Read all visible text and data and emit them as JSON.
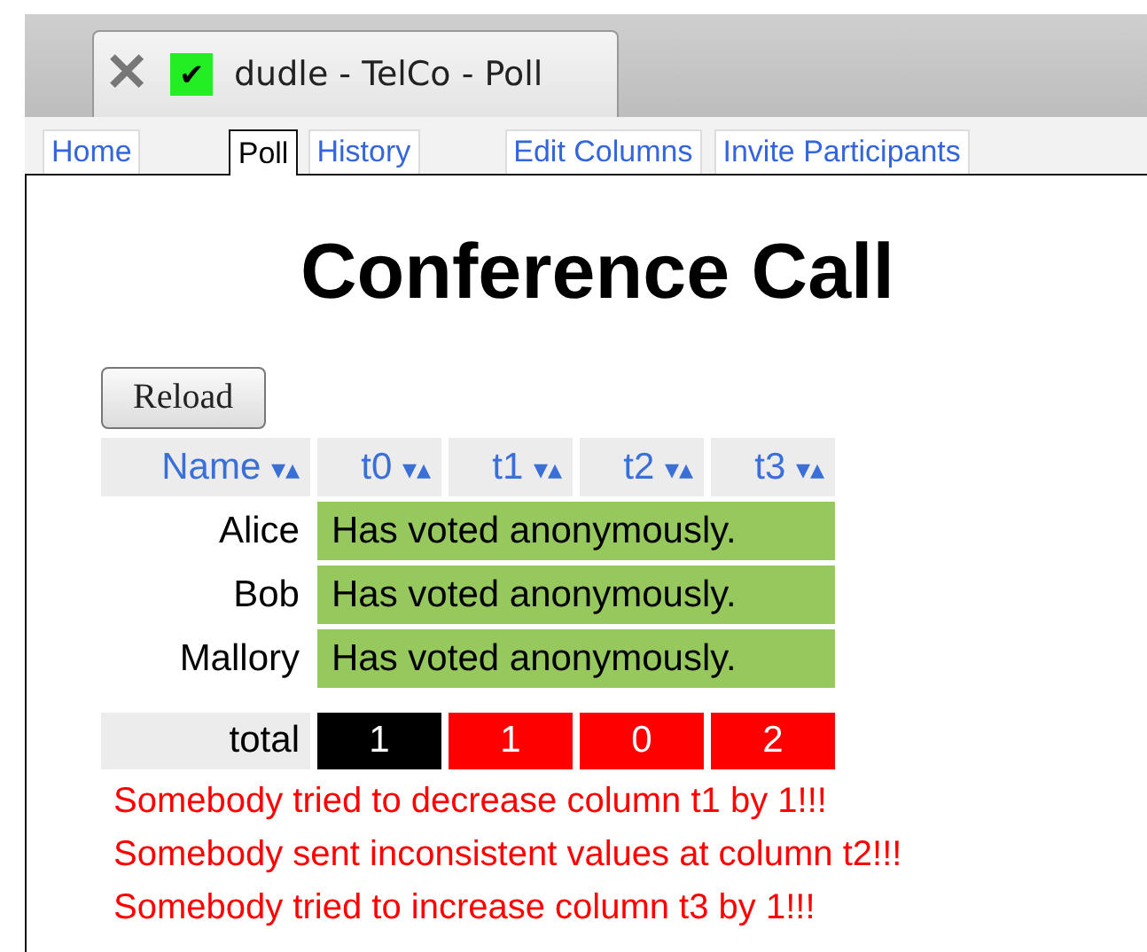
{
  "browser_tab": {
    "title": "dudle - TelCo - Poll",
    "close": "✕",
    "favicon": "✔"
  },
  "nav_tabs": [
    {
      "label": "Home",
      "selected": false
    },
    {
      "label": "Poll",
      "selected": true
    },
    {
      "label": "History",
      "selected": false
    },
    {
      "label": "Edit Columns",
      "selected": false
    },
    {
      "label": "Invite Participants",
      "selected": false
    }
  ],
  "heading": "Conference Call",
  "reload_button": "Reload",
  "table": {
    "columns": [
      {
        "label": "Name",
        "sort": "▾▴"
      },
      {
        "label": "t0",
        "sort": "▾▴"
      },
      {
        "label": "t1",
        "sort": "▾▴"
      },
      {
        "label": "t2",
        "sort": "▾▴"
      },
      {
        "label": "t3",
        "sort": "▾▴"
      }
    ],
    "rows": [
      {
        "name": "Alice",
        "vote": "Has voted anonymously."
      },
      {
        "name": "Bob",
        "vote": "Has voted anonymously."
      },
      {
        "name": "Mallory",
        "vote": "Has voted anonymously."
      }
    ],
    "total": {
      "label": "total",
      "cells": [
        {
          "value": "1",
          "valid": true
        },
        {
          "value": "1",
          "valid": false
        },
        {
          "value": "0",
          "valid": false
        },
        {
          "value": "2",
          "valid": false
        }
      ]
    }
  },
  "errors": [
    "Somebody tried to decrease column t1 by 1!!!",
    "Somebody sent inconsistent values at column t2!!!",
    "Somebody tried to increase column t3 by 1!!!"
  ]
}
